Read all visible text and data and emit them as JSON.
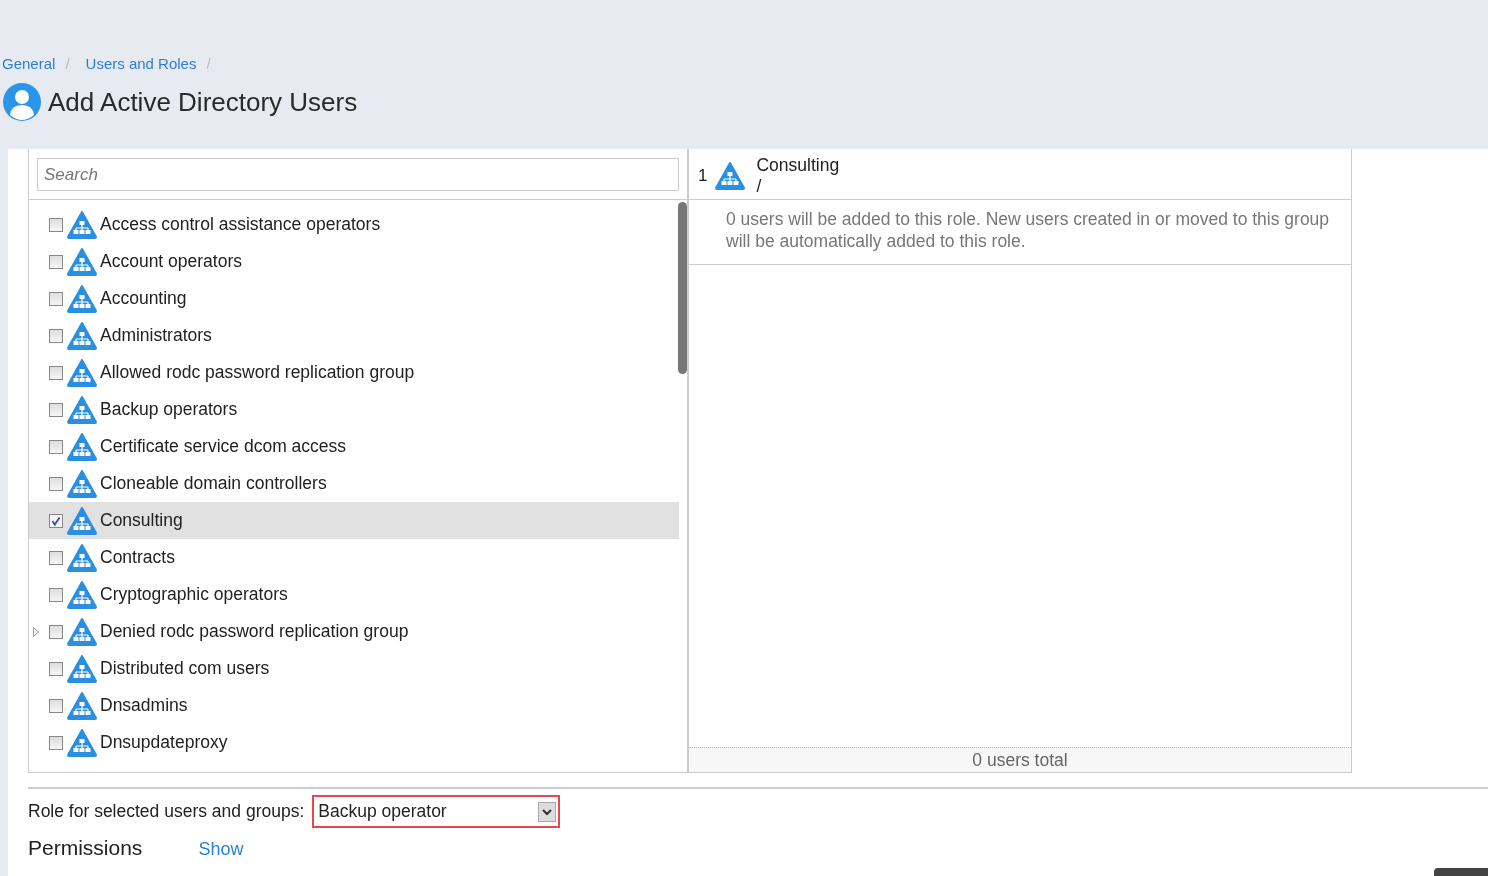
{
  "breadcrumbs": [
    {
      "label": "General",
      "separator": "/"
    },
    {
      "label": "Users and Roles",
      "separator": "/"
    }
  ],
  "page_title": "Add Active Directory Users",
  "search": {
    "placeholder": "Search"
  },
  "groups": [
    {
      "label": "Access control assistance operators",
      "checked": false,
      "selected": false,
      "expandable": false
    },
    {
      "label": "Account operators",
      "checked": false,
      "selected": false,
      "expandable": false
    },
    {
      "label": "Accounting",
      "checked": false,
      "selected": false,
      "expandable": false
    },
    {
      "label": "Administrators",
      "checked": false,
      "selected": false,
      "expandable": false
    },
    {
      "label": "Allowed rodc password replication group",
      "checked": false,
      "selected": false,
      "expandable": false
    },
    {
      "label": "Backup operators",
      "checked": false,
      "selected": false,
      "expandable": false
    },
    {
      "label": "Certificate service dcom access",
      "checked": false,
      "selected": false,
      "expandable": false
    },
    {
      "label": "Cloneable domain controllers",
      "checked": false,
      "selected": false,
      "expandable": false
    },
    {
      "label": "Consulting",
      "checked": true,
      "selected": true,
      "expandable": false
    },
    {
      "label": "Contracts",
      "checked": false,
      "selected": false,
      "expandable": false
    },
    {
      "label": "Cryptographic operators",
      "checked": false,
      "selected": false,
      "expandable": false
    },
    {
      "label": "Denied rodc password replication group",
      "checked": false,
      "selected": false,
      "expandable": true
    },
    {
      "label": "Distributed com users",
      "checked": false,
      "selected": false,
      "expandable": false
    },
    {
      "label": "Dnsadmins",
      "checked": false,
      "selected": false,
      "expandable": false
    },
    {
      "label": "Dnsupdateproxy",
      "checked": false,
      "selected": false,
      "expandable": false
    }
  ],
  "selected_groups": [
    {
      "index": "1",
      "name": "Consulting",
      "path": "/",
      "note": "0 users will be added to this role. New users created in or moved to this group will be automatically added to this role."
    }
  ],
  "total": "0 users total",
  "role": {
    "label": "Role for selected users and groups:",
    "value": "Backup operator"
  },
  "permissions": {
    "label": "Permissions",
    "link": "Show"
  }
}
